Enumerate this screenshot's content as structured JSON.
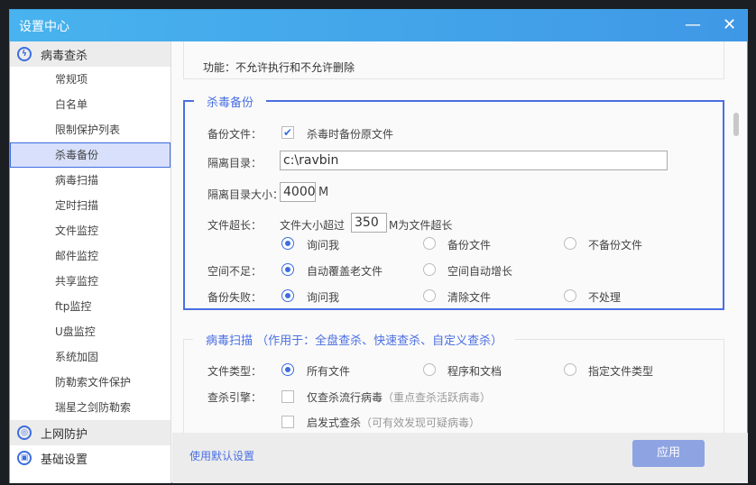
{
  "window": {
    "title": "设置中心",
    "minimize": "—",
    "close": "✕"
  },
  "sidebar": {
    "groups": [
      {
        "label": "病毒查杀",
        "icon": "virus-scan-icon"
      },
      {
        "label": "上网防护",
        "icon": "web-protect-icon"
      },
      {
        "label": "基础设置",
        "icon": "basic-settings-icon"
      }
    ],
    "items": [
      "常规项",
      "白名单",
      "限制保护列表",
      "杀毒备份",
      "病毒扫描",
      "定时扫描",
      "文件监控",
      "邮件监控",
      "共享监控",
      "ftp监控",
      "U盘监控",
      "系统加固",
      "防勒索文件保护",
      "瑞星之剑防勒索"
    ],
    "selected": "杀毒备份"
  },
  "top": {
    "text": "功能：不允许执行和不允许删除"
  },
  "backup": {
    "title": "杀毒备份",
    "backup_file_label": "备份文件：",
    "backup_file_option": "杀毒时备份原文件",
    "backup_file_checked": true,
    "quarantine_dir_label": "隔离目录：",
    "quarantine_dir_value": "c:\\ravbin",
    "dir_size_label": "隔离目录大小：",
    "dir_size_value": "4000",
    "dir_size_unit": "M",
    "oversize_label": "文件超长：",
    "oversize_prefix": "文件大小超过",
    "oversize_value": "350",
    "oversize_suffix": "M为文件超长",
    "oversize_options": [
      "询问我",
      "备份文件",
      "不备份文件"
    ],
    "oversize_selected": 0,
    "space_label": "空间不足：",
    "space_options": [
      "自动覆盖老文件",
      "空间自动增长"
    ],
    "space_selected": 0,
    "fail_label": "备份失败：",
    "fail_options": [
      "询问我",
      "清除文件",
      "不处理"
    ],
    "fail_selected": 0
  },
  "scan": {
    "title": "病毒扫描 （作用于：全盘查杀、快速查杀、自定义查杀）",
    "file_type_label": "文件类型：",
    "file_type_options": [
      "所有文件",
      "程序和文档",
      "指定文件类型"
    ],
    "file_type_selected": 0,
    "engine_label": "查杀引擎：",
    "engine_options": [
      {
        "label": "仅查杀流行病毒",
        "hint": "（重点查杀活跃病毒）",
        "checked": false
      },
      {
        "label": "启发式查杀",
        "hint": "（可有效发现可疑病毒）",
        "checked": false
      }
    ]
  },
  "footer": {
    "default_link": "使用默认设置",
    "apply": "应用"
  },
  "colors": {
    "accent": "#4a6fe3",
    "title_bar": "#48b3ee"
  }
}
